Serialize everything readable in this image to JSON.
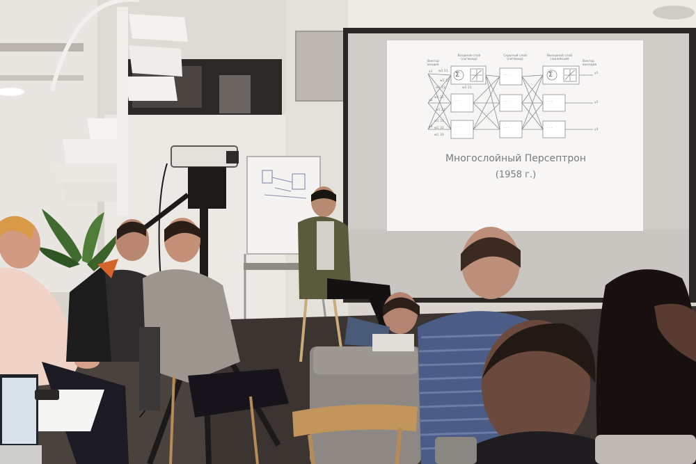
{
  "slide": {
    "title": "Многослойный Персептрон",
    "year": "(1958 г.)",
    "input_vector_label": "Вектор входов",
    "input_layer_label": "Входной слой (сигмоид)",
    "hidden_layer_label": "Скрытый слой (сигмоид)",
    "output_layer_label": "Выходной слой (линейный)",
    "output_vector_label": "Вектор выходов",
    "sum_symbol": "Σ",
    "inputs": [
      "x1",
      "x2",
      "x3"
    ],
    "outputs": [
      "y1",
      "y2",
      "y3"
    ],
    "weights": [
      "w1 11",
      "w1 12",
      "w1 13",
      "w1 21",
      "w1 22",
      "w1 23",
      "w1 31",
      "w1 32",
      "w1 33"
    ],
    "node_dots": "· · ·"
  },
  "colors": {
    "screen": "#cbc7c3",
    "slide_bg": "#f7f6f4",
    "wall": "#e6e2dc",
    "floor": "#3a3430",
    "presenter_jacket": "#5a5a3c",
    "audience_dark": "#1f1b19"
  }
}
